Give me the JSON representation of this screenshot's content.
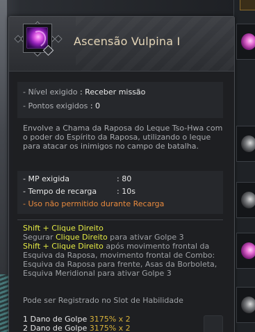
{
  "skill": {
    "name": "Ascensão Vulpina I",
    "icon": "fox-flame-skill-icon"
  },
  "requirements": {
    "level_label": "- Nível exigido",
    "level_value": ": Receber missão",
    "points_label": "- Pontos exigidos",
    "points_value": ": 0"
  },
  "description": "Envolve a Chama da Raposa do Leque Tso-Hwa com o poder do Espírito da Raposa, utilizando o leque para atacar os inimigos no campo de batalha.",
  "stats": {
    "mp_label": "- MP exigida",
    "mp_value": ": 80",
    "cooldown_label": "- Tempo de recarga",
    "cooldown_value": ": 10s",
    "restriction": "- Uso não permitido durante Recarga"
  },
  "controls": {
    "combo1_title": "Shift + Clique Direito",
    "combo1_pre": "Segurar ",
    "combo1_key": "Clique Direito",
    "combo1_post": " para ativar Golpe 3",
    "combo2_key": "Shift + Clique Direito",
    "combo2_text": " após movimento frontal da Esquiva da Raposa, movimento frontal de Combo: Esquiva da Raposa para frente, Asas da Borboleta, Esquiva Meridional para ativar Golpe 3",
    "slot_note": "Pode ser Registrado no Slot de Habilidade"
  },
  "damage": [
    {
      "label": "1 Dano de Golpe ",
      "value": "3175% x 2"
    },
    {
      "label": "2 Dano de Golpe ",
      "value": "3175% x 2"
    }
  ],
  "colors": {
    "title": "#e6d7b8",
    "highlight": "#e6ec44",
    "warning": "#e88a3e",
    "damage": "#d8b23a"
  }
}
